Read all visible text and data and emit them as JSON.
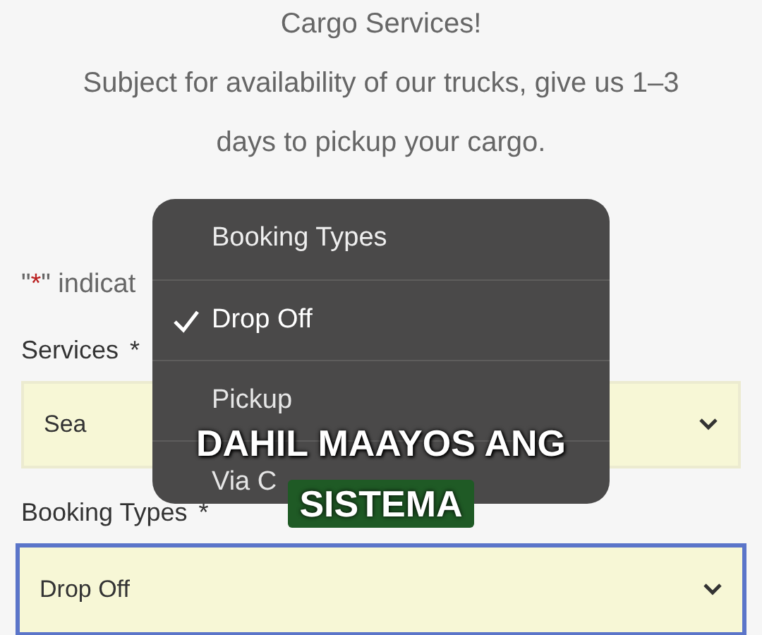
{
  "intro": [
    "Cargo Services!",
    "Subject for availability of our trucks, give us 1–3 days to pickup your cargo."
  ],
  "note": {
    "open": "\"",
    "mark": "*",
    "rest": "\" indicat"
  },
  "fields": [
    {
      "label": "Services",
      "required": true,
      "value": "Sea",
      "focused": false
    },
    {
      "label": "Booking Types",
      "required": true,
      "value": "Drop Off",
      "focused": true
    }
  ],
  "menu": {
    "title": "Booking Types",
    "options": [
      {
        "label": "Drop Off",
        "selected": true
      },
      {
        "label": "Pickup",
        "selected": false
      },
      {
        "label": "Via C",
        "selected": false
      }
    ]
  },
  "caption": [
    "DAHIL MAAYOS ANG",
    "SISTEMA"
  ]
}
